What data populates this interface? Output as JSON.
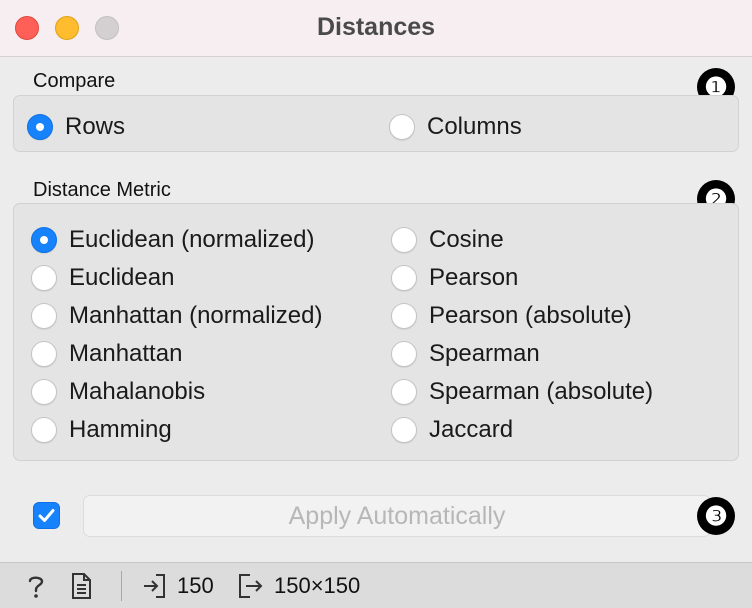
{
  "window": {
    "title": "Distances",
    "traffic_lights": [
      "close",
      "minimize",
      "zoom"
    ]
  },
  "compare": {
    "label": "Compare",
    "options": [
      {
        "label": "Rows",
        "selected": true
      },
      {
        "label": "Columns",
        "selected": false
      }
    ]
  },
  "metric": {
    "label": "Distance Metric",
    "left_options": [
      {
        "label": "Euclidean (normalized)",
        "selected": true
      },
      {
        "label": "Euclidean",
        "selected": false
      },
      {
        "label": "Manhattan (normalized)",
        "selected": false
      },
      {
        "label": "Manhattan",
        "selected": false
      },
      {
        "label": "Mahalanobis",
        "selected": false
      },
      {
        "label": "Hamming",
        "selected": false
      }
    ],
    "right_options": [
      {
        "label": "Cosine",
        "selected": false
      },
      {
        "label": "Pearson",
        "selected": false
      },
      {
        "label": "Pearson (absolute)",
        "selected": false
      },
      {
        "label": "Spearman",
        "selected": false
      },
      {
        "label": "Spearman (absolute)",
        "selected": false
      },
      {
        "label": "Jaccard",
        "selected": false
      }
    ]
  },
  "badges": [
    "❶",
    "❷",
    "❸"
  ],
  "apply": {
    "checked": true,
    "label": "Apply Automatically"
  },
  "statusbar": {
    "input_count": "150",
    "output_size": "150×150",
    "icons": [
      "help-icon",
      "report-icon",
      "input-icon",
      "output-icon"
    ]
  },
  "colors": {
    "accent": "#1682fb",
    "close": "#fe5f57",
    "minimize": "#febc2e",
    "zoom": "#d4d0d1"
  }
}
